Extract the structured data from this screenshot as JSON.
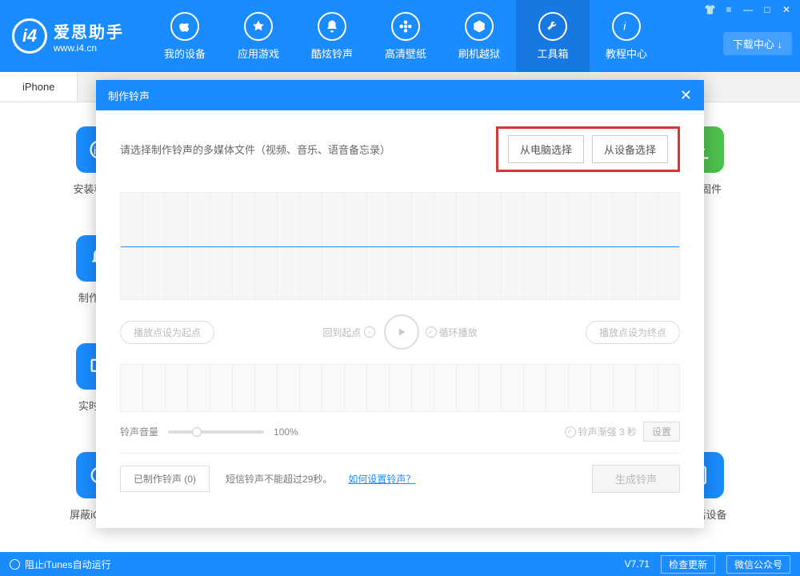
{
  "header": {
    "logo_mark": "i4",
    "logo_title": "爱思助手",
    "logo_sub": "www.i4.cn",
    "download_center": "下载中心 ↓",
    "nav": [
      {
        "label": "我的设备"
      },
      {
        "label": "应用游戏"
      },
      {
        "label": "酷炫铃声"
      },
      {
        "label": "高清壁纸"
      },
      {
        "label": "刷机越狱"
      },
      {
        "label": "工具箱"
      },
      {
        "label": "教程中心"
      }
    ]
  },
  "tabs": {
    "iphone": "iPhone"
  },
  "tools": {
    "t0": "安装移动端",
    "t1": "下载固件",
    "t2": "制作铃声",
    "t3": "实时屏幕",
    "t4": "屏蔽iOS更新",
    "t5": "反激活设备"
  },
  "modal": {
    "title": "制作铃声",
    "hint": "请选择制作铃声的多媒体文件（视频、音乐、语音备忘录）",
    "from_pc": "从电脑选择",
    "from_device": "从设备选择",
    "set_start": "播放点设为起点",
    "back_start": "回到起点",
    "loop": "循环播放",
    "set_end": "播放点设为终点",
    "volume_label": "铃声音量",
    "volume_value": "100%",
    "fade_label": "铃声渐强 3 秒",
    "set_btn": "设置",
    "created_label": "已制作铃声 (0)",
    "sms_hint": "短信铃声不能超过29秒。",
    "howto_link": "如何设置铃声？",
    "generate": "生成铃声"
  },
  "status": {
    "left": "阻止iTunes自动运行",
    "version": "V7.71",
    "check_update": "检查更新",
    "wechat": "微信公众号"
  }
}
